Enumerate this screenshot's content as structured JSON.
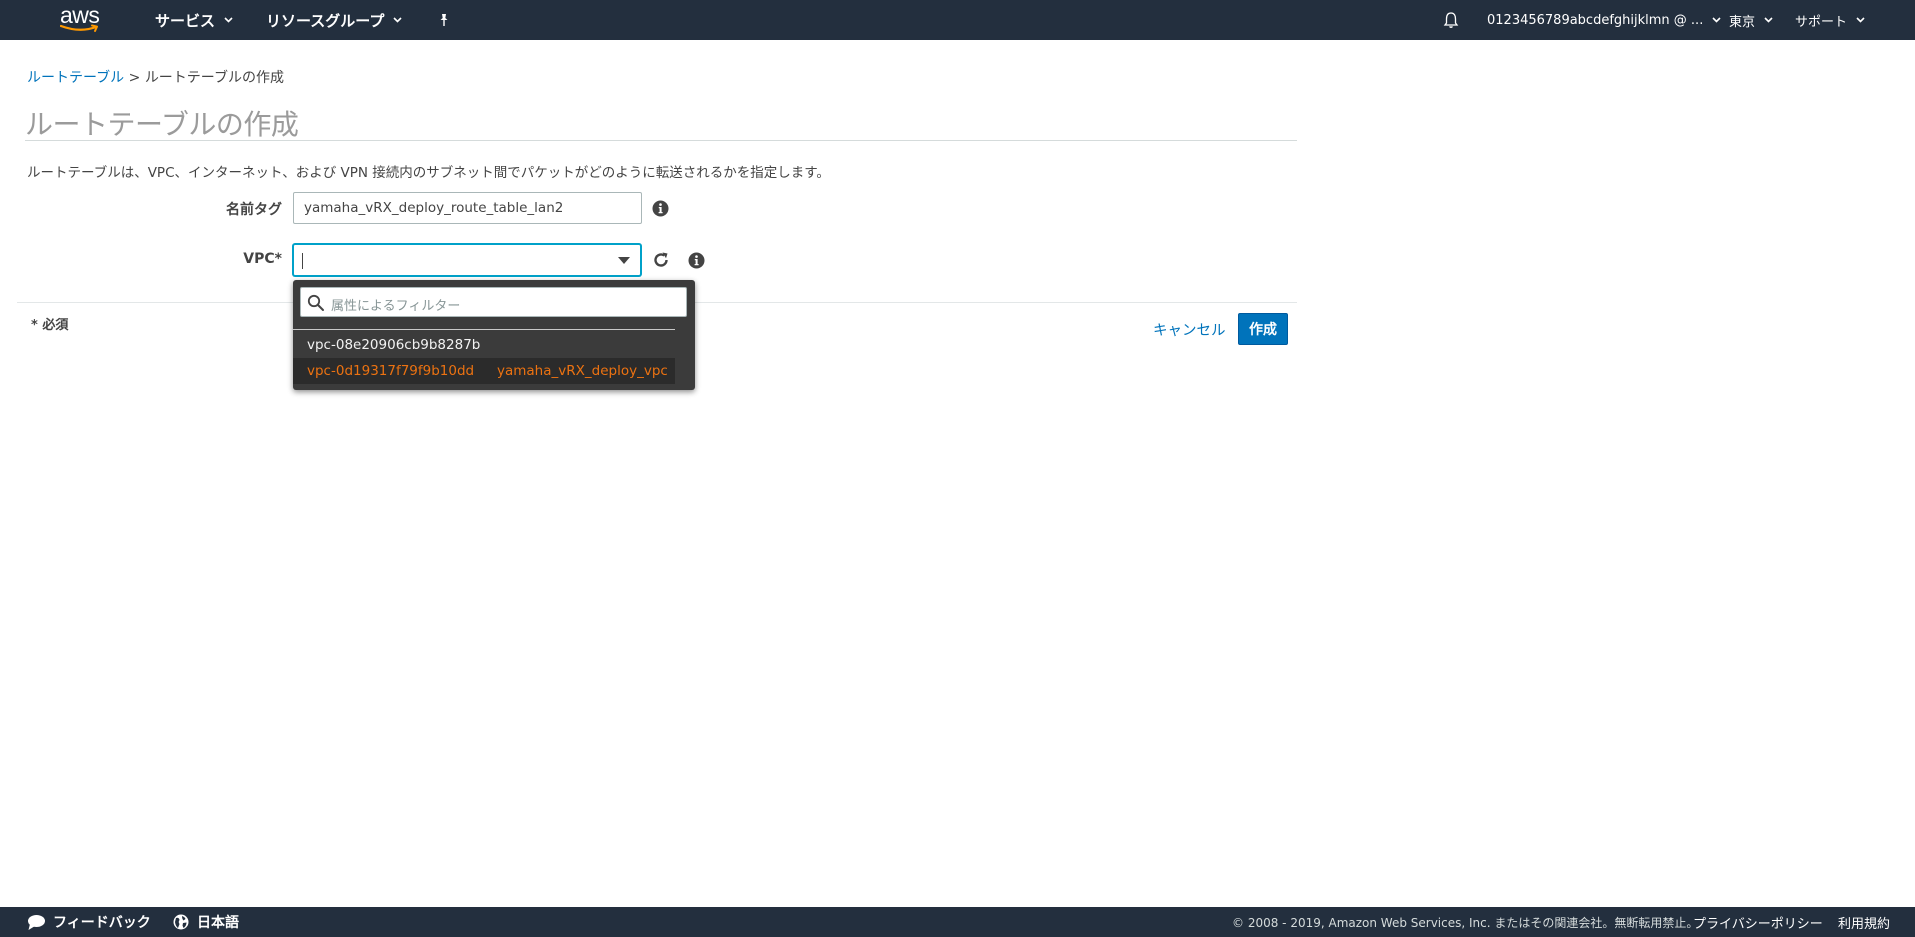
{
  "header": {
    "logo_text": "aws",
    "services_label": "サービス",
    "resource_groups_label": "リソースグループ",
    "account_label": "0123456789abcdefghijklmn @ ...",
    "region_label": "東京",
    "support_label": "サポート"
  },
  "breadcrumb": {
    "parent": "ルートテーブル",
    "separator": ">",
    "current": "ルートテーブルの作成"
  },
  "page": {
    "title": "ルートテーブルの作成",
    "description": "ルートテーブルは、VPC、インターネット、および VPN 接続内のサブネット間でパケットがどのように転送されるかを指定します。"
  },
  "form": {
    "name_tag_label": "名前タグ",
    "name_tag_value": "yamaha_vRX_deploy_route_table_lan2",
    "vpc_label": "VPC*",
    "vpc_value": "",
    "required_note": "* 必須",
    "cancel_label": "キャンセル",
    "create_label": "作成"
  },
  "dropdown": {
    "filter_placeholder": "属性によるフィルター",
    "options": [
      {
        "id": "vpc-08e20906cb9b8287b",
        "name": ""
      },
      {
        "id": "vpc-0d19317f79f9b10dd",
        "name": "yamaha_vRX_deploy_vpc",
        "highlighted": true
      }
    ]
  },
  "footer": {
    "feedback_label": "フィードバック",
    "language_label": "日本語",
    "copyright": "© 2008 - 2019, Amazon Web Services, Inc. またはその関連会社。無断転用禁止。",
    "privacy_label": "プライバシーポリシー",
    "terms_label": "利用規約"
  },
  "colors": {
    "nav_bg": "#232f3e",
    "link": "#0073bb",
    "primary_button": "#0073bb",
    "highlight_text": "#ec7211",
    "focus_border": "#00a1c9"
  }
}
